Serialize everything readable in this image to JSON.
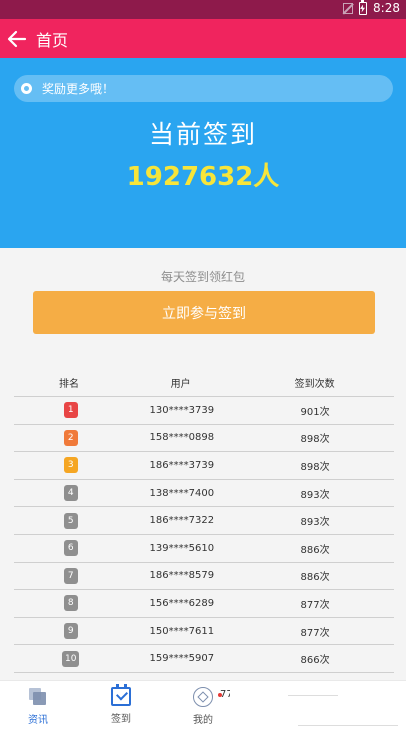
{
  "status_bar": {
    "time": "8:28"
  },
  "header": {
    "title": "首页"
  },
  "hero": {
    "notice": "奖励更多哦！",
    "title": "当前签到",
    "count": "1927632人"
  },
  "signup": {
    "tagline": "每天签到领红包",
    "button_label": "立即参与签到"
  },
  "table": {
    "columns": [
      "排名",
      "用户",
      "签到次数"
    ],
    "rows": [
      {
        "rank": "1",
        "user": "130****3739",
        "count": "901次",
        "color": "#e84545"
      },
      {
        "rank": "2",
        "user": "158****0898",
        "count": "898次",
        "color": "#f07a3a"
      },
      {
        "rank": "3",
        "user": "186****3739",
        "count": "898次",
        "color": "#f5a623"
      },
      {
        "rank": "4",
        "user": "138****7400",
        "count": "893次",
        "color": "#8f8f8f"
      },
      {
        "rank": "5",
        "user": "186****7322",
        "count": "893次",
        "color": "#8f8f8f"
      },
      {
        "rank": "6",
        "user": "139****5610",
        "count": "886次",
        "color": "#8f8f8f"
      },
      {
        "rank": "7",
        "user": "186****8579",
        "count": "886次",
        "color": "#8f8f8f"
      },
      {
        "rank": "8",
        "user": "156****6289",
        "count": "877次",
        "color": "#8f8f8f"
      },
      {
        "rank": "9",
        "user": "150****7611",
        "count": "877次",
        "color": "#8f8f8f"
      },
      {
        "rank": "10",
        "user": "159****5907",
        "count": "866次",
        "color": "#8f8f8f"
      }
    ]
  },
  "bottom_nav": {
    "items": [
      {
        "label": "资讯",
        "icon": "news-icon",
        "color": "#2b6fd6"
      },
      {
        "label": "签到",
        "icon": "checkin-icon",
        "color": "#555555"
      },
      {
        "label": "我的",
        "icon": "profile-icon",
        "color": "#555555"
      }
    ],
    "overlay_text": "77"
  },
  "colors": {
    "status_bar": "#8e1a4b",
    "app_bar": "#f0245e",
    "hero": "#2aa5f0",
    "count_text": "#f7e53a",
    "cta": "#f5ad45"
  }
}
